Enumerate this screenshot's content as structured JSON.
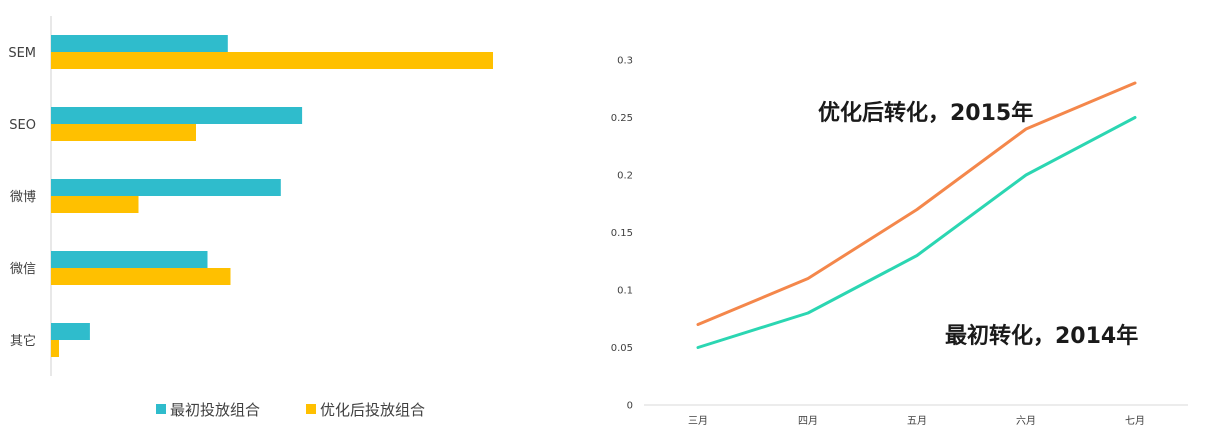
{
  "chart_data": [
    {
      "type": "bar",
      "orientation": "horizontal",
      "title": "",
      "xlabel": "",
      "ylabel": "",
      "xlim": [
        0,
        0.5
      ],
      "axis_ticks_visible": false,
      "grid": false,
      "legend_position": "bottom",
      "categories": [
        "SEM",
        "SEO",
        "微博",
        "微信",
        "其它"
      ],
      "series": [
        {
          "name": "最初投放组合",
          "color": "#2FBCCC",
          "values": [
            0.2,
            0.284,
            0.26,
            0.177,
            0.044
          ]
        },
        {
          "name": "优化后投放组合",
          "color": "#FFC000",
          "values": [
            0.5,
            0.164,
            0.099,
            0.203,
            0.009
          ]
        }
      ]
    },
    {
      "type": "line",
      "title": "",
      "xlabel": "",
      "ylabel": "",
      "ylim": [
        0,
        0.3
      ],
      "grid": false,
      "x": [
        "三月",
        "四月",
        "五月",
        "六月",
        "七月"
      ],
      "y_ticks": [
        "0",
        "0.05",
        "0.1",
        "0.15",
        "0.2",
        "0.25",
        "0.3"
      ],
      "series": [
        {
          "name": "优化后转化，2015年",
          "color": "#F4874B",
          "values": [
            0.07,
            0.11,
            0.17,
            0.24,
            0.28
          ]
        },
        {
          "name": "最初转化，2014年",
          "color": "#2BD6B2",
          "values": [
            0.05,
            0.08,
            0.13,
            0.2,
            0.25
          ]
        }
      ],
      "annotations": [
        {
          "text": "优化后转化，2015年",
          "series": 0
        },
        {
          "text": "最初转化，2014年",
          "series": 1
        }
      ]
    }
  ]
}
